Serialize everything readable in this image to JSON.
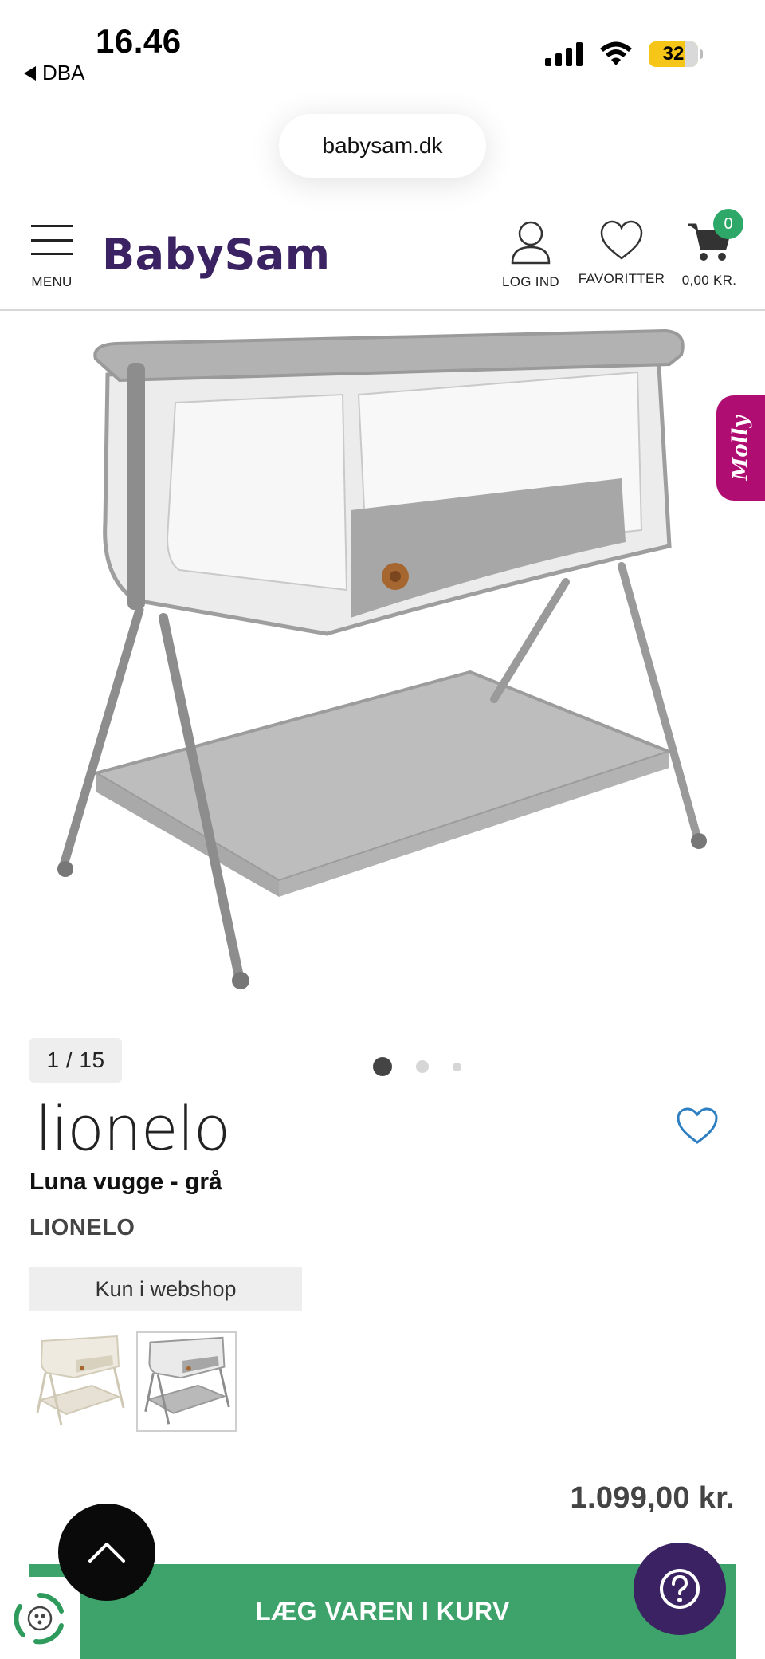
{
  "status_bar": {
    "time": "16.46",
    "back_app": "DBA",
    "battery": "32"
  },
  "browser": {
    "url": "babysam.dk"
  },
  "header": {
    "menu_label": "MENU",
    "logo": "BabySam",
    "login_label": "LOG IND",
    "favorites_label": "FAVORITTER",
    "cart_total": "0,00 KR.",
    "cart_count": "0",
    "brand_color": "#3b2262"
  },
  "gallery": {
    "counter": "1 / 15",
    "dots": 3,
    "active_dot": 1,
    "side_tab": "Molly",
    "side_tab_color": "#b00d73"
  },
  "product": {
    "brand_logo": "lionelo",
    "title": "Luna vugge - grå",
    "brand": "LIONELO",
    "availability": "Kun i webshop",
    "variants": [
      {
        "name": "beige",
        "frame_color": "#d9d3c3"
      },
      {
        "name": "grey",
        "frame_color": "#8f9196",
        "selected": true
      }
    ],
    "price": "1.099,00 kr."
  },
  "actions": {
    "add_to_cart": "LÆG VAREN I KURV",
    "add_to_cart_color": "#3da36b",
    "scroll_top_icon": "chevron-up-icon",
    "help_icon": "question-icon",
    "eco_icon": "recycle-icon"
  }
}
